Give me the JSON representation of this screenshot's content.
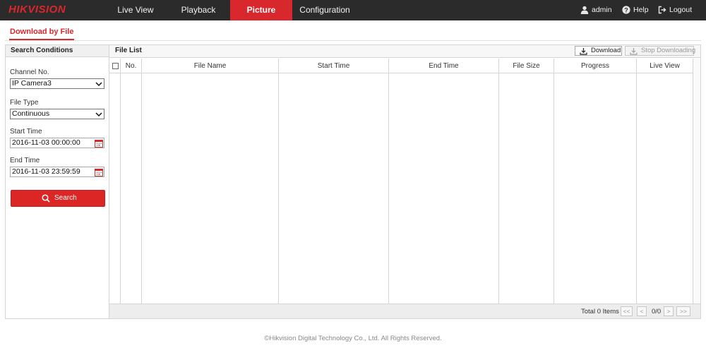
{
  "brand": {
    "logo_text": "HIKVISION",
    "accent": "#d9272e"
  },
  "nav": {
    "items": [
      {
        "label": "Live View",
        "active": false
      },
      {
        "label": "Playback",
        "active": false
      },
      {
        "label": "Picture",
        "active": true
      },
      {
        "label": "Configuration",
        "active": false
      }
    ]
  },
  "user_menu": {
    "user": {
      "label": "admin",
      "icon": "user-icon"
    },
    "help": {
      "label": "Help",
      "icon": "help-icon"
    },
    "logout": {
      "label": "Logout",
      "icon": "logout-icon"
    }
  },
  "subtab": {
    "label": "Download by File"
  },
  "search_panel": {
    "title": "Search Conditions",
    "channel": {
      "label": "Channel No.",
      "value": "IP Camera3"
    },
    "file_type": {
      "label": "File Type",
      "value": "Continuous"
    },
    "start_time": {
      "label": "Start Time",
      "value": "2016-11-03 00:00:00"
    },
    "end_time": {
      "label": "End Time",
      "value": "2016-11-03 23:59:59"
    },
    "search_button": {
      "label": "Search",
      "icon": "search-icon"
    }
  },
  "file_list": {
    "title": "File List",
    "download_button": {
      "label": "Download",
      "icon": "download-icon"
    },
    "stop_button": {
      "label": "Stop Downloading",
      "icon": "stop-download-icon"
    },
    "columns": [
      "No.",
      "File Name",
      "Start Time",
      "End Time",
      "File Size",
      "Progress",
      "Live View"
    ],
    "rows": [],
    "pagination": {
      "total_text": "Total 0 Items",
      "first": "<<",
      "prev": "<",
      "page_info": "0/0",
      "next": ">",
      "last": ">>"
    }
  },
  "footer": {
    "copyright": "©Hikvision Digital Technology Co., Ltd. All Rights Reserved."
  }
}
